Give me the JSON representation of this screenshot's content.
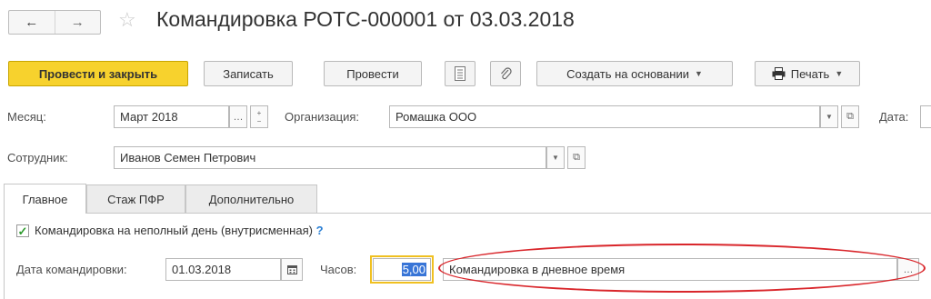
{
  "header": {
    "back_glyph": "←",
    "forward_glyph": "→",
    "title": "Командировка РОТС-000001 от 03.03.2018"
  },
  "toolbar": {
    "post_close": "Провести и закрыть",
    "save": "Записать",
    "post": "Провести",
    "create_based": "Создать на основании",
    "print": "Печать"
  },
  "form": {
    "month_label": "Месяц:",
    "month_value": "Март 2018",
    "org_label": "Организация:",
    "org_value": "Ромашка ООО",
    "date_label": "Дата:",
    "employee_label": "Сотрудник:",
    "employee_value": "Иванов Семен Петрович"
  },
  "tabs": [
    {
      "label": "Главное",
      "active": true
    },
    {
      "label": "Стаж ПФР",
      "active": false
    },
    {
      "label": "Дополнительно",
      "active": false
    }
  ],
  "main": {
    "partial_day_label": "Командировка на неполный день (внутрисменная)",
    "partial_day_checked": true,
    "help_mark": "?",
    "trip_date_label": "Дата командировки:",
    "trip_date_value": "01.03.2018",
    "hours_label": "Часов:",
    "hours_value": "5,00",
    "reason_value": "Командировка в дневное время"
  },
  "colors": {
    "primary_button": "#f7d22d",
    "highlight_oval": "#d9262b",
    "hours_focus": "#f0c020",
    "selection": "#3875d7"
  }
}
